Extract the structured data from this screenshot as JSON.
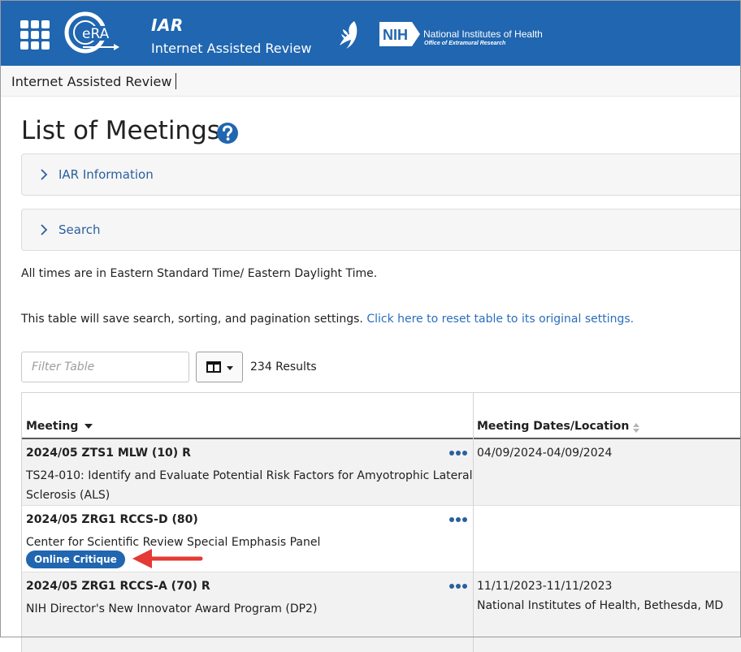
{
  "header": {
    "app_title": "IAR",
    "app_subtitle": "Internet Assisted Review",
    "era_logo_text": "eRA",
    "nih_logo_text": "NIH",
    "nih_name": "National Institutes of Health",
    "nih_office": "Office of Extramural Research",
    "icons": [
      "apps-grid-icon",
      "era-logo",
      "hhs-eagle-icon",
      "nih-logo"
    ],
    "colors": {
      "bar": "#2066b0"
    }
  },
  "breadcrumb": {
    "label": "Internet Assisted Review"
  },
  "page": {
    "title": "List of Meetings",
    "help_icon": "question-circle-icon"
  },
  "accordions": {
    "info": {
      "label": "IAR Information"
    },
    "search": {
      "label": "Search"
    }
  },
  "notes": {
    "timezone": "All times are in Eastern Standard Time/ Eastern Daylight Time.",
    "save_settings": "This table will save search, sorting, and pagination settings.",
    "reset_link": "Click here to reset table to its original settings."
  },
  "controls": {
    "filter_placeholder": "Filter Table",
    "column_toggle_icon": "columns-icon",
    "results": "234 Results"
  },
  "table": {
    "headers": {
      "meeting": "Meeting",
      "dates": "Meeting Dates/Location"
    },
    "rows": [
      {
        "code": "2024/05 ZTS1 MLW (10) R",
        "title": "TS24-010: Identify and Evaluate Potential Risk Factors for Amyotrophic Lateral Sclerosis (ALS)",
        "dates": "04/09/2024-04/09/2024",
        "location": ""
      },
      {
        "code": "2024/05 ZRG1 RCCS-D (80)",
        "title": "Center for Scientific Review Special Emphasis Panel",
        "badge": "Online Critique",
        "dates": "",
        "location": ""
      },
      {
        "code": "2024/05 ZRG1 RCCS-A (70) R",
        "title": "NIH Director's New Innovator Award Program (DP2)",
        "dates": "11/11/2023-11/11/2023",
        "location": "National Institutes of Health, Bethesda, MD"
      }
    ]
  },
  "annotation": {
    "arrow_color": "#e53935"
  }
}
